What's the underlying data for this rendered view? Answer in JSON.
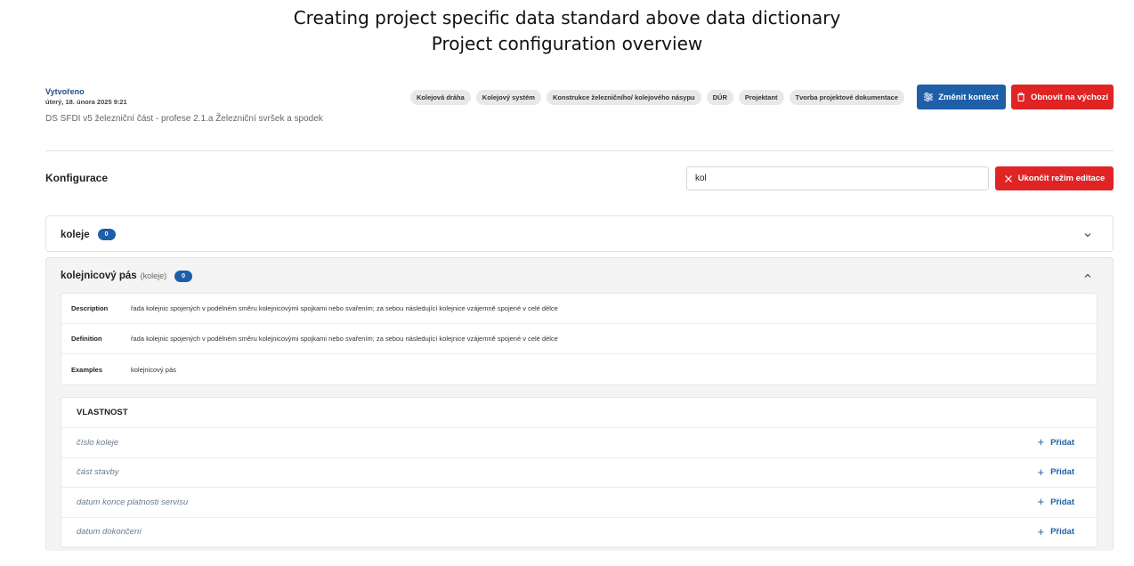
{
  "slide": {
    "title_line1": "Creating project specific data standard above data dictionary",
    "title_line2": "Project configuration overview"
  },
  "header": {
    "created_label": "Vytvořeno",
    "created_date": "úterý, 18. února 2025 9:21",
    "path": "DS SFDI v5 železniční část - profese 2.1.a Železniční svršek a spodek",
    "tags": [
      "Kolejová dráha",
      "Kolejový systém",
      "Konstrukce železničního/ kolejového násypu",
      "DÚR",
      "Projektant",
      "Tvorba projektové dokumentace"
    ],
    "change_context_label": "Změnit kontext",
    "reset_label": "Obnovit na výchozí"
  },
  "config": {
    "title": "Konfigurace",
    "search_value": "kol",
    "end_edit_label": "Ukončit režim editace"
  },
  "items": [
    {
      "name": "koleje",
      "parent": "",
      "count": "0",
      "expanded": false
    },
    {
      "name": "kolejnicový pás",
      "parent": "(koleje)",
      "count": "0",
      "expanded": true
    }
  ],
  "details": [
    {
      "key": "Description",
      "value": "řada kolejnic spojených v podélném směru kolejnicovými spojkami nebo svařením; za sebou následující kolejnice vzájemně spojené v celé délce"
    },
    {
      "key": "Definition",
      "value": "řada kolejnic spojených v podélném směru kolejnicovými spojkami nebo svařením; za sebou následující kolejnice vzájemně spojené v celé délce"
    },
    {
      "key": "Examples",
      "value": "kolejnicový pás"
    }
  ],
  "properties": {
    "header": "VLASTNOST",
    "add_label": "Přidat",
    "rows": [
      "číslo koleje",
      "část stavby",
      "datum konce platnosti servisu",
      "datum dokončení"
    ]
  },
  "colors": {
    "primary": "#1e5fa8",
    "danger": "#e02424",
    "tag_bg": "#e8e8e8"
  },
  "icons": [
    "sliders-icon",
    "trash-icon",
    "close-icon",
    "chevron-down-icon",
    "chevron-up-icon",
    "plus-icon"
  ]
}
